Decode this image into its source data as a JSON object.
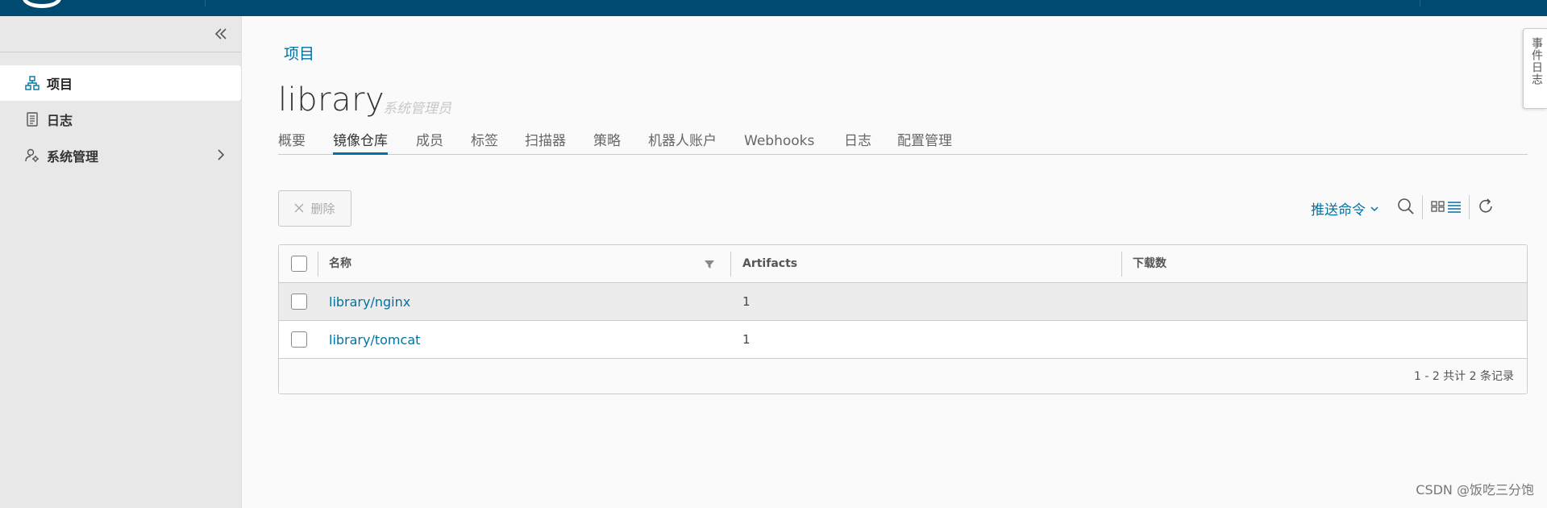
{
  "sidebar": {
    "items": [
      {
        "label": "项目",
        "icon": "project-icon"
      },
      {
        "label": "日志",
        "icon": "log-icon"
      },
      {
        "label": "系统管理",
        "icon": "admin-settings-icon"
      }
    ]
  },
  "breadcrumb": "项目",
  "project": {
    "name": "library",
    "role": "系统管理员"
  },
  "tabs": [
    "概要",
    "镜像仓库",
    "成员",
    "标签",
    "扫描器",
    "策略",
    "机器人账户",
    "Webhooks",
    "日志",
    "配置管理"
  ],
  "toolbar": {
    "delete_label": "删除",
    "push_command_label": "推送命令"
  },
  "grid": {
    "columns": [
      "名称",
      "Artifacts",
      "下载数"
    ],
    "rows": [
      {
        "name": "library/nginx",
        "artifacts": "1",
        "pulls": ""
      },
      {
        "name": "library/tomcat",
        "artifacts": "1",
        "pulls": ""
      }
    ],
    "footer": "1 - 2 共计 2 条记录"
  },
  "event_log_tab": "事件日志",
  "watermark": "CSDN @饭吃三分饱",
  "colors": {
    "header": "#004a70",
    "accent": "#0072a3"
  }
}
